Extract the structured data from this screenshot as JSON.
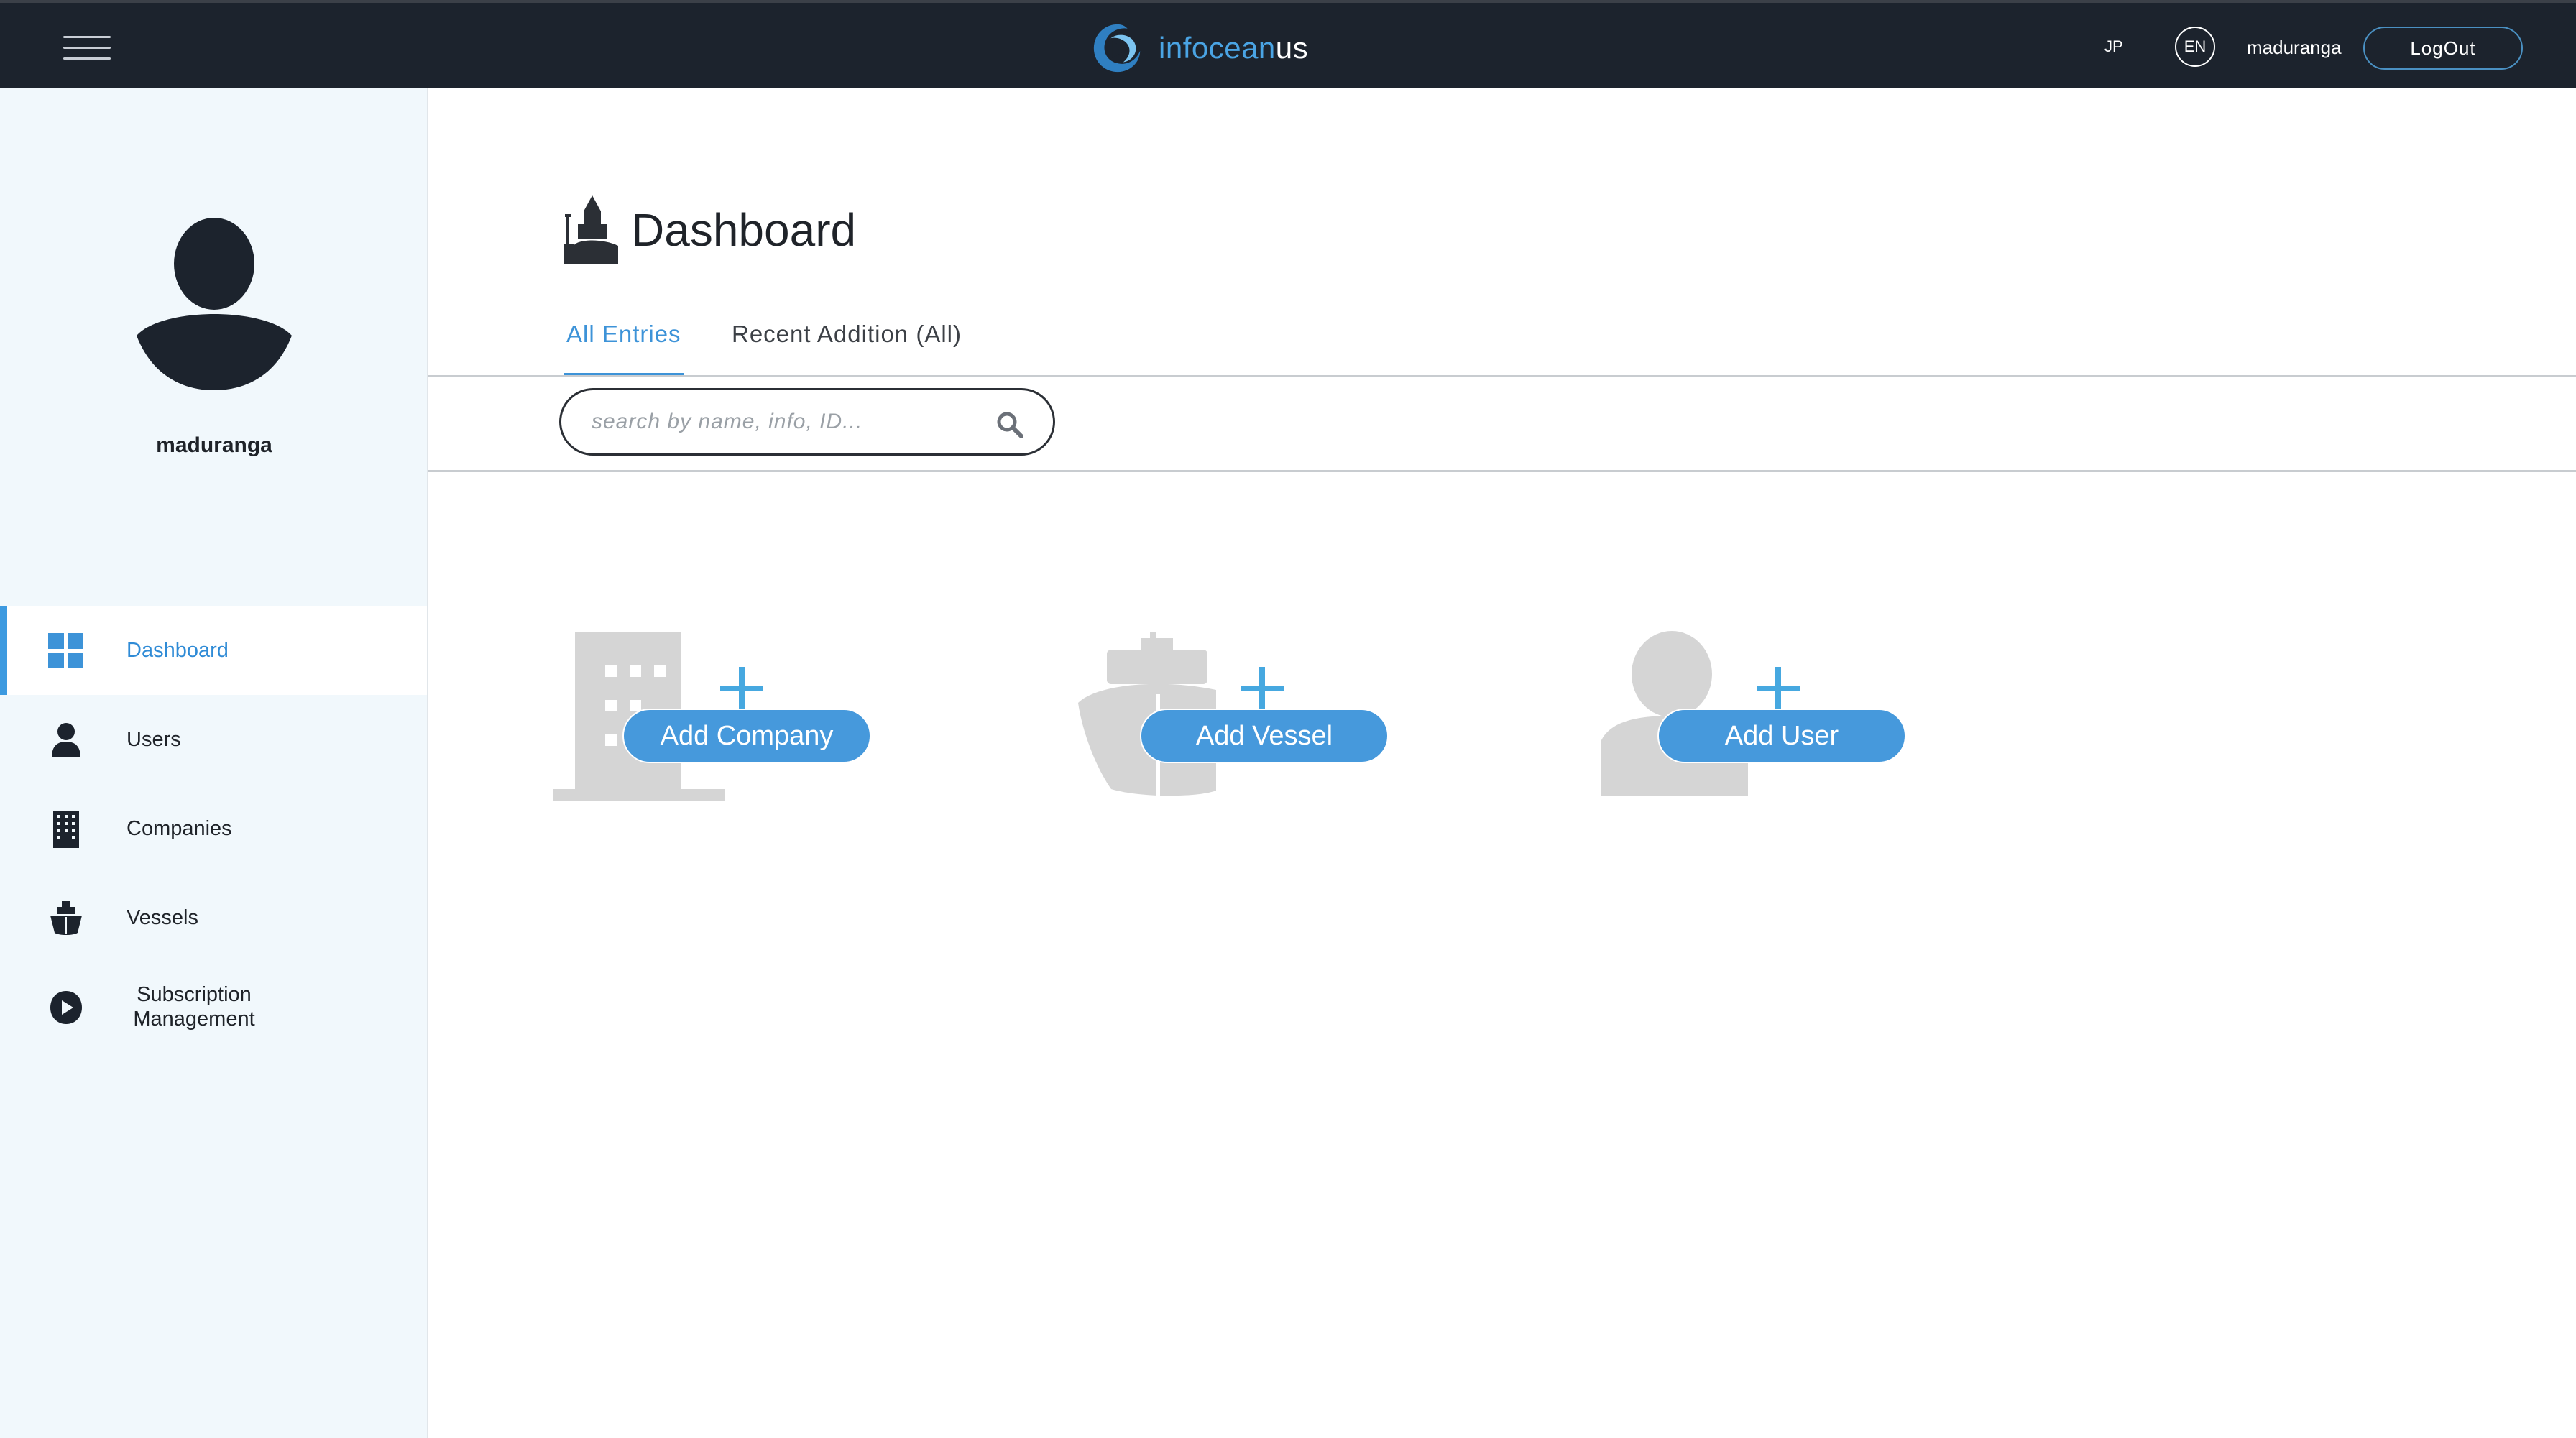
{
  "topbar": {
    "brand_prefix": "infocean",
    "brand_suffix": "us",
    "lang_jp": "JP",
    "lang_en": "EN",
    "username": "maduranga",
    "logout_label": "LogOut"
  },
  "sidebar": {
    "username": "maduranga",
    "items": [
      {
        "label": "Dashboard",
        "icon": "grid-icon",
        "active": true
      },
      {
        "label": "Users",
        "icon": "user-icon",
        "active": false
      },
      {
        "label": "Companies",
        "icon": "building-icon",
        "active": false
      },
      {
        "label": "Vessels",
        "icon": "ship-icon",
        "active": false
      },
      {
        "label": "Subscription Management",
        "icon": "subscription-icon",
        "active": false
      }
    ]
  },
  "main": {
    "title": "Dashboard",
    "tabs": [
      {
        "label": "All Entries",
        "active": true
      },
      {
        "label": "Recent Addition (All)",
        "active": false
      }
    ],
    "search": {
      "placeholder": "search by name, info, ID...",
      "value": ""
    },
    "cards": [
      {
        "label": "Add Company",
        "icon": "building-icon"
      },
      {
        "label": "Add Vessel",
        "icon": "ship-icon"
      },
      {
        "label": "Add User",
        "icon": "user-icon"
      }
    ]
  },
  "colors": {
    "topbar_bg": "#1c232d",
    "accent": "#4699dc",
    "sidebar_bg": "#f1f8fc",
    "placeholder_icon": "#d3d3d3"
  }
}
